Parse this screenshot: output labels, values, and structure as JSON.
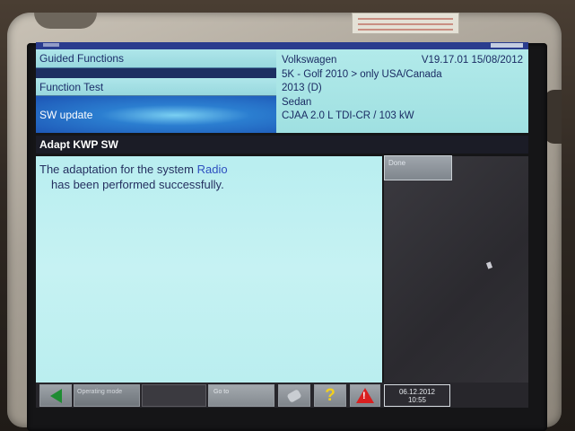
{
  "menu": {
    "items": [
      {
        "label": "Guided Functions"
      },
      {
        "label": "Function Test"
      },
      {
        "label": "SW update"
      }
    ]
  },
  "vehicle": {
    "make": "Volkswagen",
    "version": "V19.17.01 15/08/2012",
    "model": "5K - Golf  2010 > only USA/Canada",
    "year": "2013 (D)",
    "body": "Sedan",
    "engine": "CJAA 2.0 L TDI-CR / 103 kW"
  },
  "section_title": "Adapt KWP SW",
  "message": {
    "line1_prefix": "The adaptation for the system ",
    "line1_system": "Radio",
    "line2": "has been performed successfully."
  },
  "buttons": {
    "done": "Done",
    "operating_mode": "Operating mode",
    "goto": "Go to",
    "help": "?"
  },
  "status": {
    "date": "06.12.2012",
    "time": "10:55"
  },
  "colors": {
    "panel_cyan": "#b9eef0",
    "selection_blue": "#1d55b5",
    "text_navy": "#1a2b63",
    "back_green": "#1e8c32",
    "warning_red": "#d91f1f",
    "help_yellow": "#f2cf1d"
  },
  "icons": {
    "back": "back-arrow-icon",
    "tools": "tools-icon",
    "help": "help-icon",
    "warning": "warning-icon"
  }
}
